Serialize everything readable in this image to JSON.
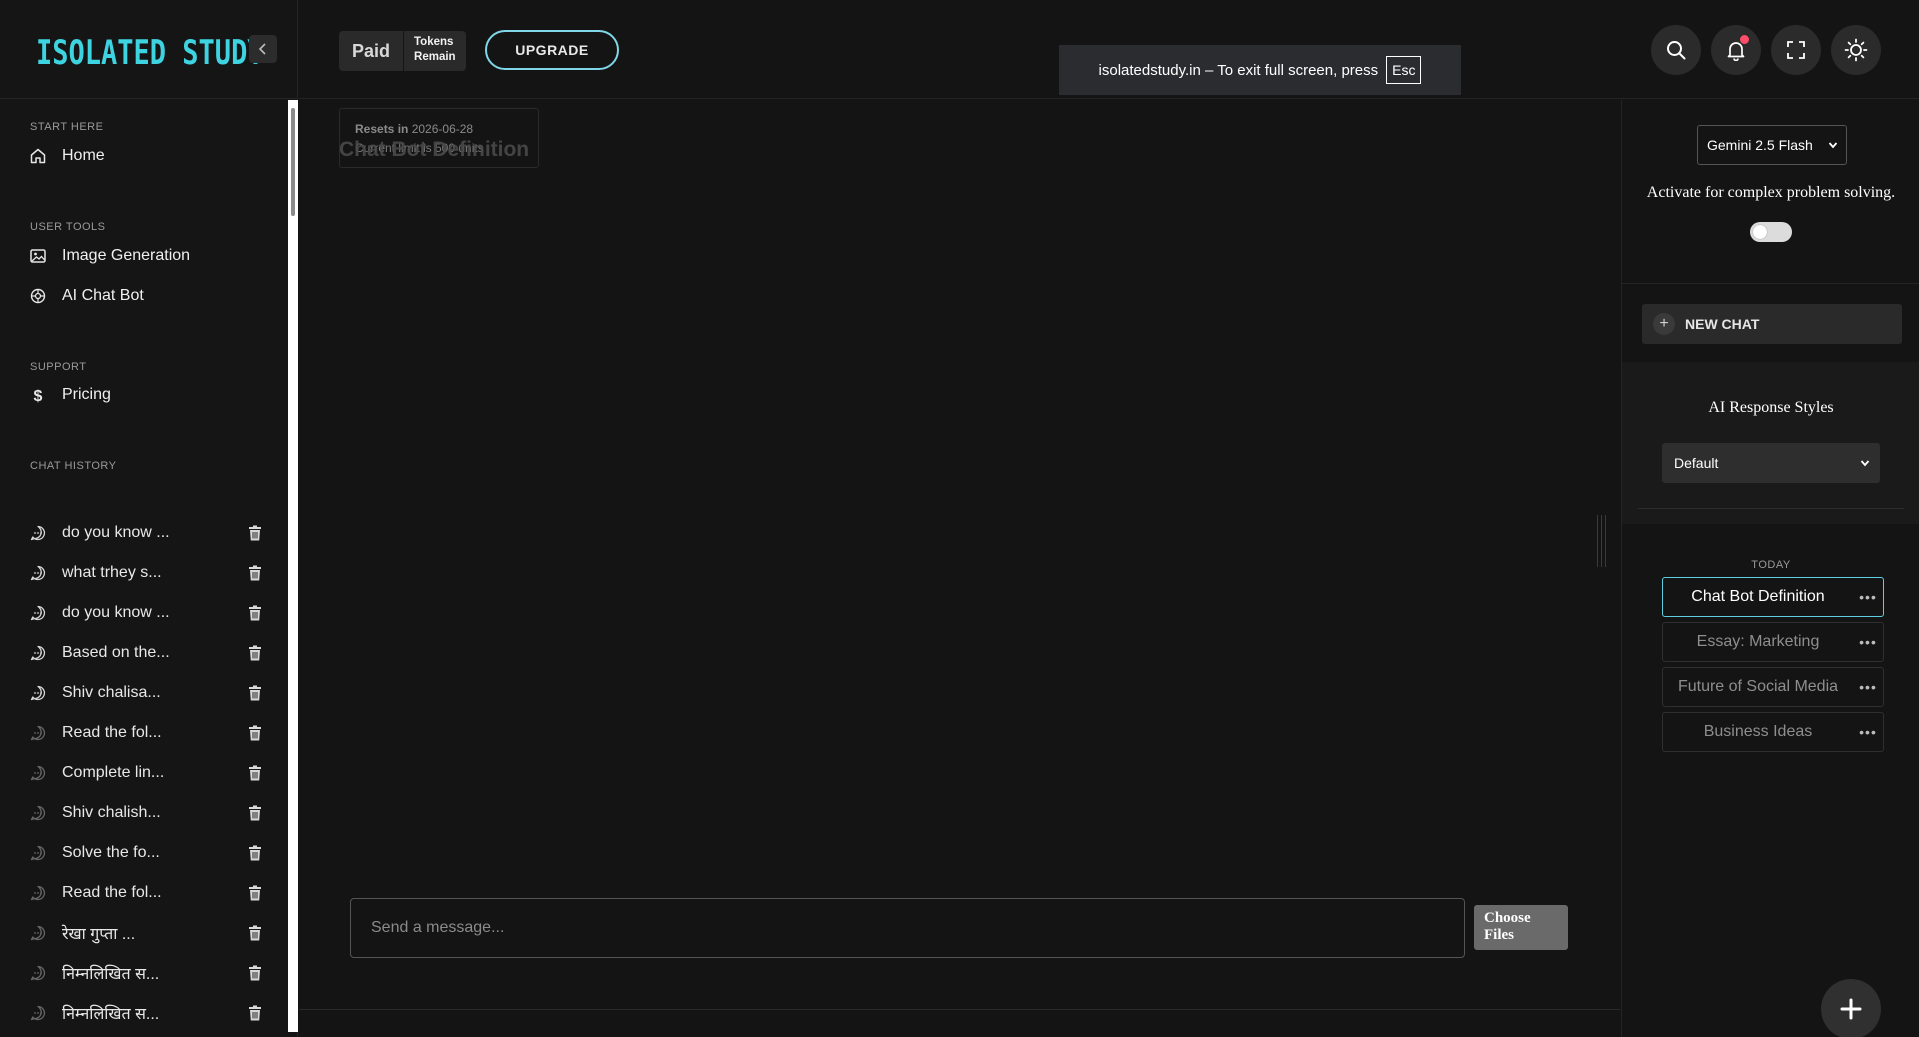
{
  "brand": {
    "logo_text": "ISOLATED STUDY"
  },
  "sidebar": {
    "sections": {
      "start": "START HERE",
      "tools": "USER TOOLS",
      "support": "SUPPORT",
      "history": "CHAT HISTORY"
    },
    "nav": {
      "home": {
        "label": "Home",
        "icon": "home-icon"
      },
      "image_gen": {
        "label": "Image Generation",
        "icon": "image-icon"
      },
      "chatbot": {
        "label": "AI Chat Bot",
        "icon": "openai-icon"
      },
      "pricing": {
        "label": "Pricing",
        "icon": "dollar-icon"
      }
    },
    "history": [
      {
        "label": "do you know ..."
      },
      {
        "label": "what trhey s..."
      },
      {
        "label": "do you know ..."
      },
      {
        "label": "Based on the..."
      },
      {
        "label": "Shiv chalisa..."
      },
      {
        "label": "Read the fol..."
      },
      {
        "label": "Complete lin..."
      },
      {
        "label": "Shiv chalish..."
      },
      {
        "label": "Solve the fo..."
      },
      {
        "label": "Read the fol..."
      },
      {
        "label": "रेखा गुप्ता ..."
      },
      {
        "label": "निम्नलिखित स..."
      },
      {
        "label": "निम्नलिखित स..."
      }
    ]
  },
  "topbar": {
    "plan": "Paid",
    "tokens_line1": "Tokens",
    "tokens_line2": "Remain",
    "upgrade_label": "UPGRADE",
    "fullscreen_notice": "isolatedstudy.in – To exit full screen, press",
    "fullscreen_key": "Esc"
  },
  "main": {
    "resets_label": "Resets in",
    "resets_date": "2026-06-28",
    "current_limit": "Current limit is 500 units",
    "chat_title": "Chat Bot Definition",
    "composer_placeholder": "Send a message...",
    "choose_files": "Choose Files"
  },
  "rightpanel": {
    "model_selected": "Gemini 2.5 Flash",
    "activate_text": "Activate for complex problem solving.",
    "new_chat_label": "NEW CHAT",
    "styles_title": "AI Response Styles",
    "style_selected": "Default",
    "today_label": "TODAY",
    "conversations": [
      {
        "label": "Chat Bot Definition",
        "active": true
      },
      {
        "label": "Essay: Marketing",
        "active": false
      },
      {
        "label": "Future of Social Media",
        "active": false
      },
      {
        "label": "Business Ideas",
        "active": false
      }
    ]
  },
  "colors": {
    "brand_cyan": "#3ed3e0",
    "background": "#141414",
    "active_border": "#5ecfe0",
    "notification_dot": "#ff4d6a"
  }
}
